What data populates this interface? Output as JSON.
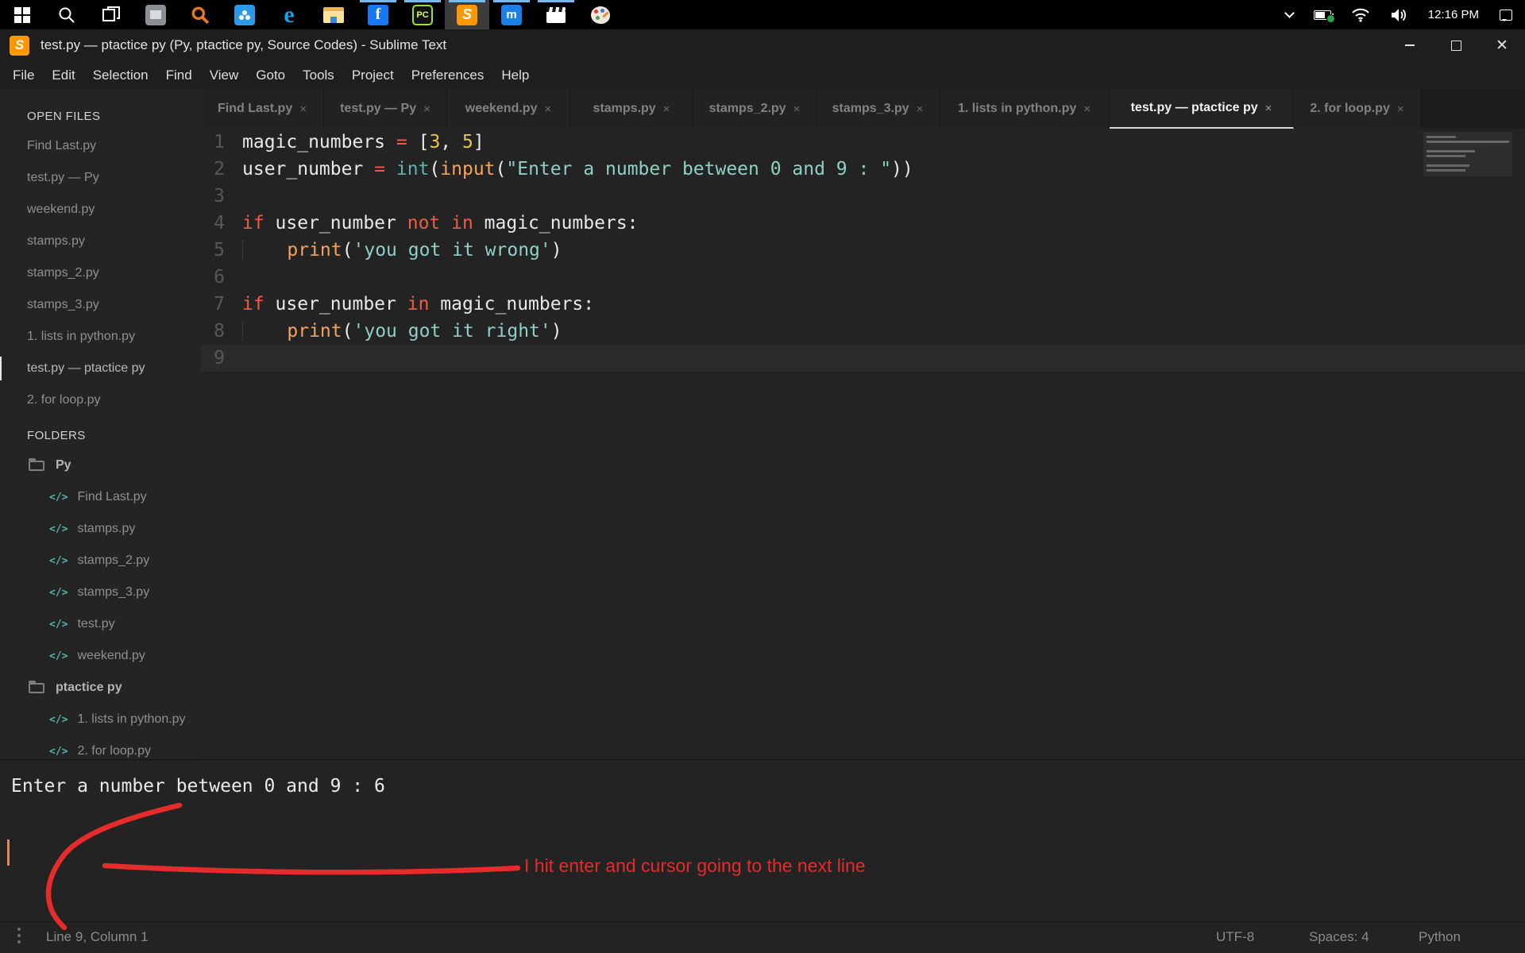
{
  "taskbar": {
    "time": "12:16 PM",
    "icons": [
      "windows-start",
      "search",
      "task-view",
      "photos-app",
      "orange-search",
      "cloud-drive",
      "edge-browser",
      "file-explorer",
      "facebook",
      "pycharm",
      "sublime-text",
      "maxthon-browser",
      "movie-clapper",
      "paint-palette"
    ],
    "tray_icons": [
      "hidden-icons-chevron",
      "battery-eco",
      "wifi",
      "volume",
      "action-center"
    ]
  },
  "window": {
    "title": "test.py — ptactice py (Py, ptactice py, Source Codes) - Sublime Text"
  },
  "menu_items": [
    "File",
    "Edit",
    "Selection",
    "Find",
    "View",
    "Goto",
    "Tools",
    "Project",
    "Preferences",
    "Help"
  ],
  "close_glyph": "×",
  "tabs": [
    {
      "label": "Find Last.py",
      "active": false
    },
    {
      "label": "test.py — Py",
      "active": false
    },
    {
      "label": "weekend.py",
      "active": false
    },
    {
      "label": "stamps.py",
      "active": false
    },
    {
      "label": "stamps_2.py",
      "active": false
    },
    {
      "label": "stamps_3.py",
      "active": false
    },
    {
      "label": "1. lists in python.py",
      "active": false
    },
    {
      "label": "test.py — ptactice py",
      "active": true
    },
    {
      "label": "2. for loop.py",
      "active": false
    }
  ],
  "sidebar": {
    "open_files_header": "OPEN FILES",
    "open_files": [
      {
        "label": "Find Last.py",
        "active": false
      },
      {
        "label": "test.py — Py",
        "active": false
      },
      {
        "label": "weekend.py",
        "active": false
      },
      {
        "label": "stamps.py",
        "active": false
      },
      {
        "label": "stamps_2.py",
        "active": false
      },
      {
        "label": "stamps_3.py",
        "active": false
      },
      {
        "label": "1. lists in python.py",
        "active": false
      },
      {
        "label": "test.py — ptactice py",
        "active": true
      },
      {
        "label": "2. for loop.py",
        "active": false
      }
    ],
    "folders_header": "FOLDERS",
    "file_glyph": "</>",
    "tree": [
      {
        "type": "folder",
        "label": "Py"
      },
      {
        "type": "file",
        "label": "Find Last.py"
      },
      {
        "type": "file",
        "label": "stamps.py"
      },
      {
        "type": "file",
        "label": "stamps_2.py"
      },
      {
        "type": "file",
        "label": "stamps_3.py"
      },
      {
        "type": "file",
        "label": "test.py"
      },
      {
        "type": "file",
        "label": "weekend.py"
      },
      {
        "type": "folder",
        "label": "ptactice py"
      },
      {
        "type": "file",
        "label": "1. lists in python.py"
      },
      {
        "type": "file",
        "label": "2. for loop.py"
      }
    ]
  },
  "editor": {
    "lines": [
      {
        "num": "1",
        "active": false,
        "tokens": [
          [
            "fg",
            "magic_numbers "
          ],
          [
            "kw",
            "= "
          ],
          [
            "pun",
            "["
          ],
          [
            "num",
            "3"
          ],
          [
            "pun",
            ", "
          ],
          [
            "num",
            "5"
          ],
          [
            "pun",
            "]"
          ]
        ]
      },
      {
        "num": "2",
        "active": false,
        "tokens": [
          [
            "fg",
            "user_number "
          ],
          [
            "kw",
            "= "
          ],
          [
            "type",
            "int"
          ],
          [
            "pun",
            "("
          ],
          [
            "fn",
            "input"
          ],
          [
            "pun",
            "("
          ],
          [
            "str",
            "\"Enter a number between 0 and 9 : \""
          ],
          [
            "pun",
            "))"
          ]
        ]
      },
      {
        "num": "3",
        "active": false,
        "tokens": []
      },
      {
        "num": "4",
        "active": false,
        "tokens": [
          [
            "kw",
            "if "
          ],
          [
            "fg",
            "user_number "
          ],
          [
            "kw",
            "not in "
          ],
          [
            "fg",
            "magic_numbers"
          ],
          [
            "pun",
            ":"
          ]
        ]
      },
      {
        "num": "5",
        "active": false,
        "tokens": [
          [
            "ind",
            "    "
          ],
          [
            "fn",
            "print"
          ],
          [
            "pun",
            "("
          ],
          [
            "str",
            "'you got it wrong'"
          ],
          [
            "pun",
            ")"
          ]
        ]
      },
      {
        "num": "6",
        "active": false,
        "tokens": []
      },
      {
        "num": "7",
        "active": false,
        "tokens": [
          [
            "kw",
            "if "
          ],
          [
            "fg",
            "user_number "
          ],
          [
            "kw",
            "in "
          ],
          [
            "fg",
            "magic_numbers"
          ],
          [
            "pun",
            ":"
          ]
        ]
      },
      {
        "num": "8",
        "active": false,
        "tokens": [
          [
            "ind",
            "    "
          ],
          [
            "fn",
            "print"
          ],
          [
            "pun",
            "("
          ],
          [
            "str",
            "'you got it right'"
          ],
          [
            "pun",
            ")"
          ]
        ]
      },
      {
        "num": "9",
        "active": true,
        "tokens": []
      }
    ]
  },
  "console": {
    "output": "Enter a number between 0 and 9 : 6",
    "annotation": "I hit enter and cursor going to the next line"
  },
  "status_bar": {
    "position": "Line 9, Column 1",
    "encoding": "UTF-8",
    "indent": "Spaces: 4",
    "syntax": "Python"
  },
  "colors": {
    "keyword": "#ee5d43",
    "number": "#e9c45c",
    "type": "#5fb4ae",
    "function": "#f5a35c",
    "string": "#8fd0c6",
    "foreground": "#e8e8e8",
    "annotation_red": "#e62b2b",
    "cursor_orange": "#dd8a5a",
    "running_indicator_blue": "#76b9ed"
  }
}
